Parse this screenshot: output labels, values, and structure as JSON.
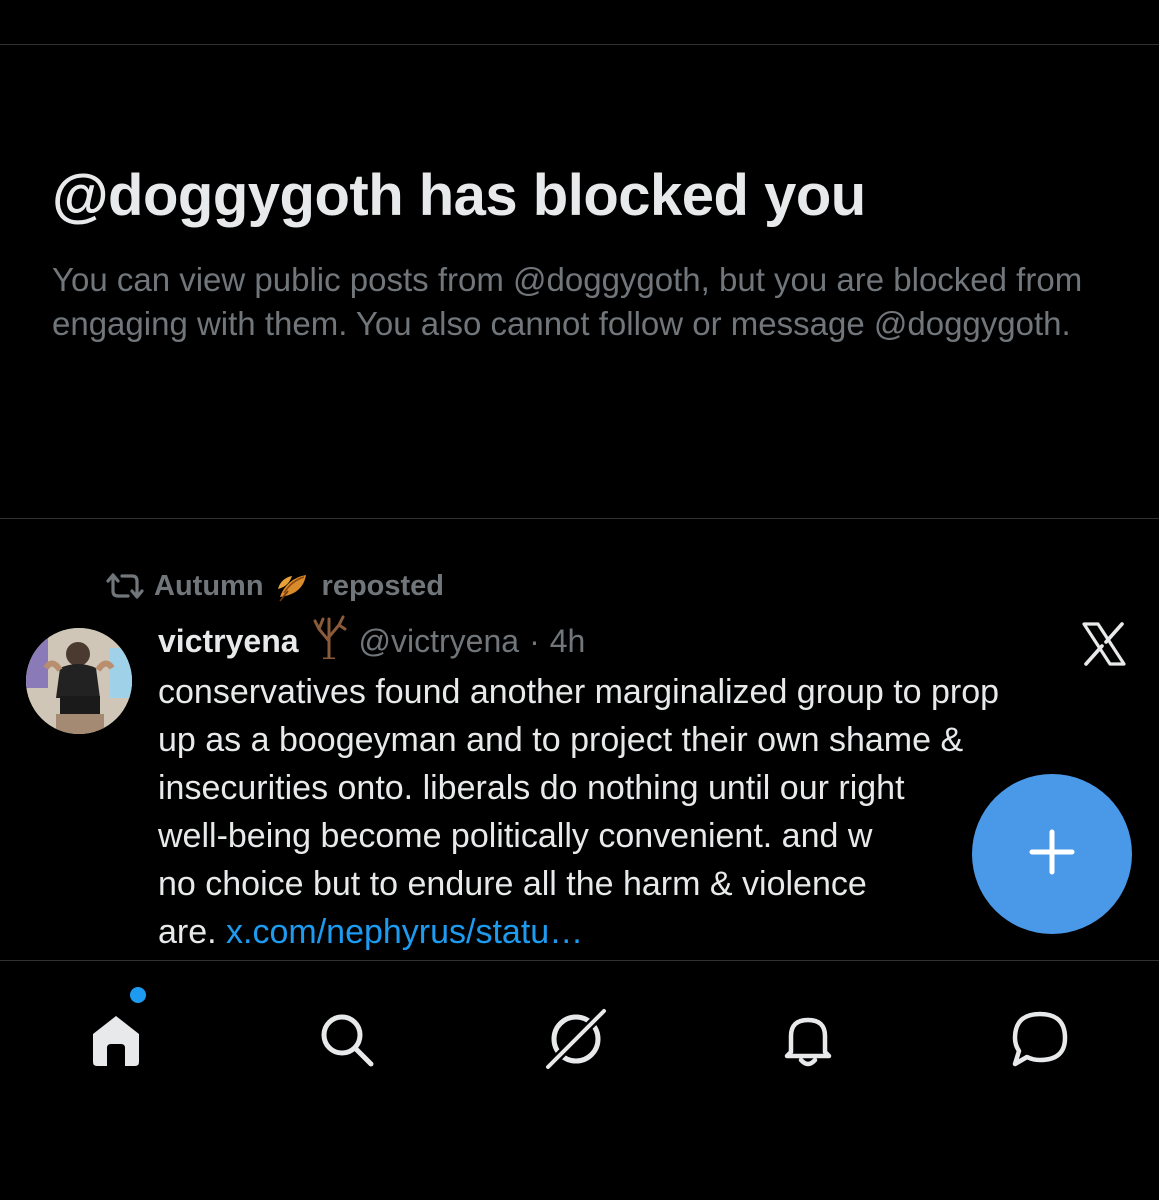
{
  "blocked": {
    "title": "@doggygoth has blocked you",
    "description": "You can view public posts from @doggygoth, but you are blocked from engaging with them. You also cannot follow or message @doggygoth."
  },
  "post": {
    "repost_user": "Autumn",
    "repost_suffix": "reposted",
    "author_name": "victryena",
    "author_handle": "@victryena",
    "separator": "·",
    "timestamp": "4h",
    "body": "conservatives found another marginalized group to prop\nup as a boogeyman and to project their own shame &\ninsecurities onto. liberals do nothing until our right\nwell-being become politically convenient. and w\nno choice but to endure all the harm & violence \nare. ",
    "link_text": "x.com/nephyrus/statu…"
  },
  "nav": {
    "items": [
      {
        "name": "home",
        "icon": "home-icon",
        "has_notification_dot": true
      },
      {
        "name": "search",
        "icon": "search-icon"
      },
      {
        "name": "grok",
        "icon": "grok-icon"
      },
      {
        "name": "notifications",
        "icon": "bell-icon"
      },
      {
        "name": "messages",
        "icon": "message-icon"
      }
    ]
  },
  "colors": {
    "background": "#000000",
    "primary_text": "#e7e9ea",
    "secondary_text": "#71767b",
    "link": "#1d9bf0",
    "fab": "#4a99e9",
    "divider": "#2f3336"
  }
}
